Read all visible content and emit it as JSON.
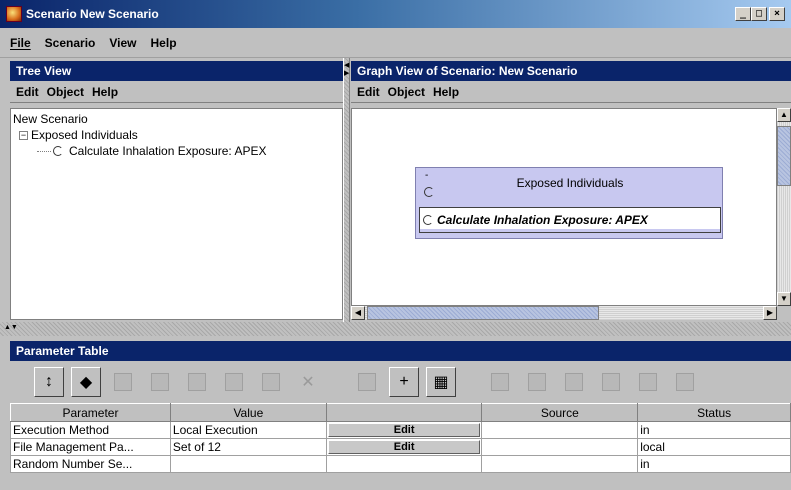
{
  "window": {
    "title": "Scenario New Scenario",
    "buttons": [
      "_",
      "□",
      "×"
    ]
  },
  "menubar": {
    "items": [
      {
        "label": "File",
        "mnemonic": "F"
      },
      {
        "label": "Scenario",
        "mnemonic": "S"
      },
      {
        "label": "View",
        "mnemonic": "V"
      },
      {
        "label": "Help",
        "mnemonic": "H"
      }
    ]
  },
  "tree_view": {
    "title": "Tree View",
    "menu": [
      "Edit",
      "Object",
      "Help"
    ],
    "root": "New Scenario",
    "group": "Exposed Individuals",
    "leaf": "Calculate Inhalation Exposure: APEX"
  },
  "graph_view": {
    "title": "Graph View of Scenario: New Scenario",
    "menu": [
      "Edit",
      "Object",
      "Help"
    ],
    "node_title": "Exposed Individuals",
    "node_collapse": "-",
    "child_label": "Calculate Inhalation Exposure: APEX"
  },
  "parameter_table": {
    "title": "Parameter Table",
    "toolbar_icons": [
      "move-up-down-icon",
      "stamp-icon",
      "undo-icon",
      "redo-icon",
      "cut-icon",
      "copy-icon",
      "paste-icon",
      "delete-icon",
      "pen-icon",
      "plus-icon",
      "add-object-icon",
      "edit-icon",
      "document-icon",
      "graph-icon",
      "object-icon",
      "window-icon",
      "table-icon",
      "ref-icon"
    ],
    "columns": [
      "Parameter",
      "Value",
      "",
      "Source",
      "Status"
    ],
    "rows": [
      {
        "parameter": "Execution Method",
        "value": "Local Execution",
        "action": "Edit",
        "source": "",
        "status": "in"
      },
      {
        "parameter": "File Management Pa...",
        "value": "Set of 12",
        "action": "Edit",
        "source": "",
        "status": "local"
      },
      {
        "parameter": "Random Number Se...",
        "value": "",
        "action": "",
        "source": "",
        "status": "in"
      }
    ]
  },
  "colors": {
    "title_bar": "#0a246a",
    "panel": "#c0c0c0",
    "graph_node": "#c8c8f0"
  }
}
